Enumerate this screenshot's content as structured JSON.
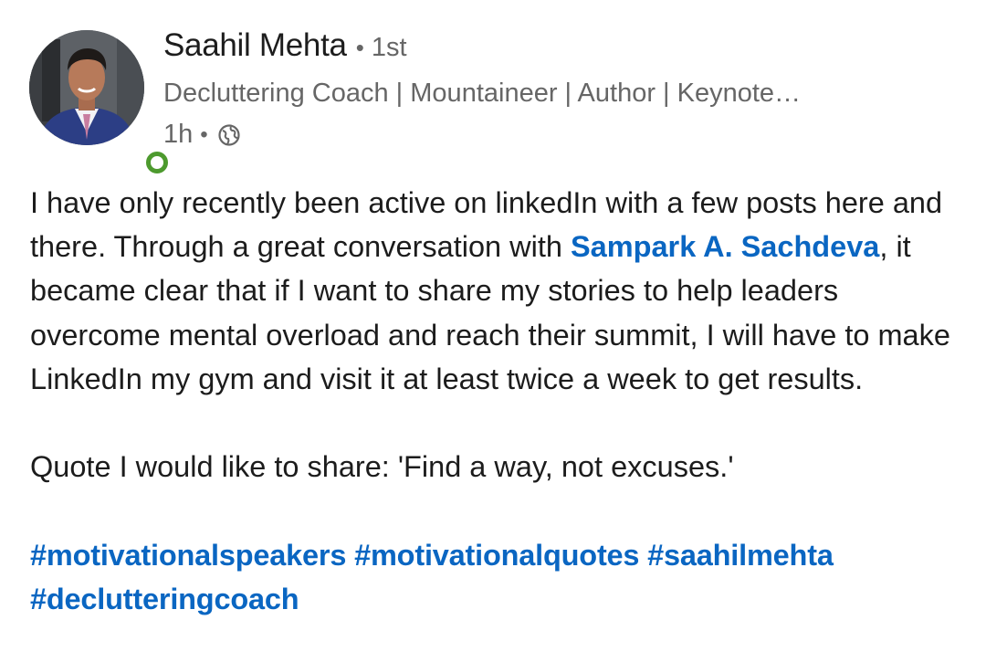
{
  "author": {
    "name": "Saahil Mehta",
    "separator": "•",
    "connection_degree": "1st",
    "headline": "Decluttering Coach | Mountaineer | Author | Keynote…",
    "time_ago": "1h",
    "meta_separator": "•",
    "visibility_icon": "globe-icon",
    "online_status": "online"
  },
  "post": {
    "line1_pre": "I have only recently been active on linkedIn with a few posts here and there. Through a great conversation with ",
    "mention": "Sampark A. Sachdeva",
    "line1_post": ", it became clear that if I want to share my stories to help leaders overcome mental overload and reach their summit, I will have to make LinkedIn my gym and visit it at least twice a week to get results.",
    "quote": "Quote I would like to share: 'Find a way, not excuses.'",
    "hashtags": [
      "#motivationalspeakers",
      "#motivationalquotes",
      "#saahilmehta",
      "#declutteringcoach"
    ]
  },
  "colors": {
    "link": "#0a66c2",
    "online": "#4d9a2e",
    "secondary_text": "#666666"
  }
}
